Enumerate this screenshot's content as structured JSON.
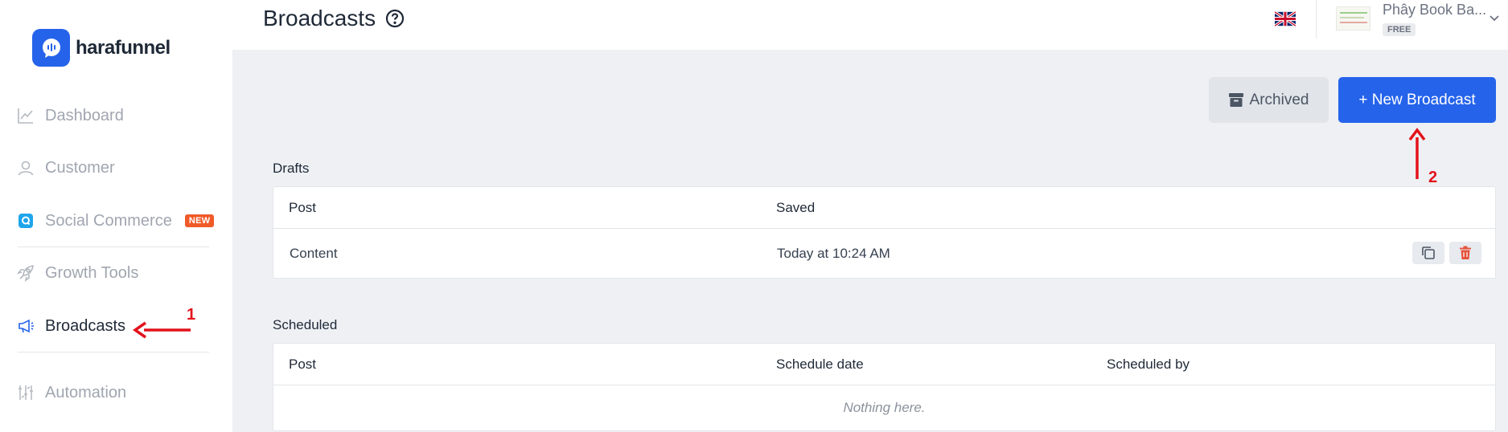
{
  "app": {
    "name": "harafunnel"
  },
  "sidebar": {
    "items": [
      {
        "label": "Dashboard",
        "icon": "chart-line-icon"
      },
      {
        "label": "Customer",
        "icon": "user-icon"
      },
      {
        "label": "Social Commerce",
        "icon": "social-commerce-icon",
        "badge": "NEW"
      },
      {
        "label": "Growth Tools",
        "icon": "rocket-icon"
      },
      {
        "label": "Broadcasts",
        "icon": "megaphone-icon",
        "active": true
      },
      {
        "label": "Automation",
        "icon": "automation-icon"
      }
    ]
  },
  "header": {
    "title": "Broadcasts",
    "language_icon": "uk-flag-icon",
    "account_name": "Phây Book Ba...",
    "plan": "FREE"
  },
  "actions": {
    "archived_label": "Archived",
    "new_broadcast_label": "+ New Broadcast"
  },
  "drafts": {
    "title": "Drafts",
    "columns": [
      "Post",
      "Saved"
    ],
    "rows": [
      {
        "post": "Content",
        "saved": "Today at 10:24 AM"
      }
    ]
  },
  "scheduled": {
    "title": "Scheduled",
    "columns": [
      "Post",
      "Schedule date",
      "Scheduled by"
    ],
    "empty_text": "Nothing here."
  },
  "annotations": {
    "step1": "1",
    "step2": "2"
  },
  "colors": {
    "brand": "#2563eb",
    "danger": "#e5533d",
    "annotation": "#e3121b",
    "new_badge": "#f05a28"
  }
}
